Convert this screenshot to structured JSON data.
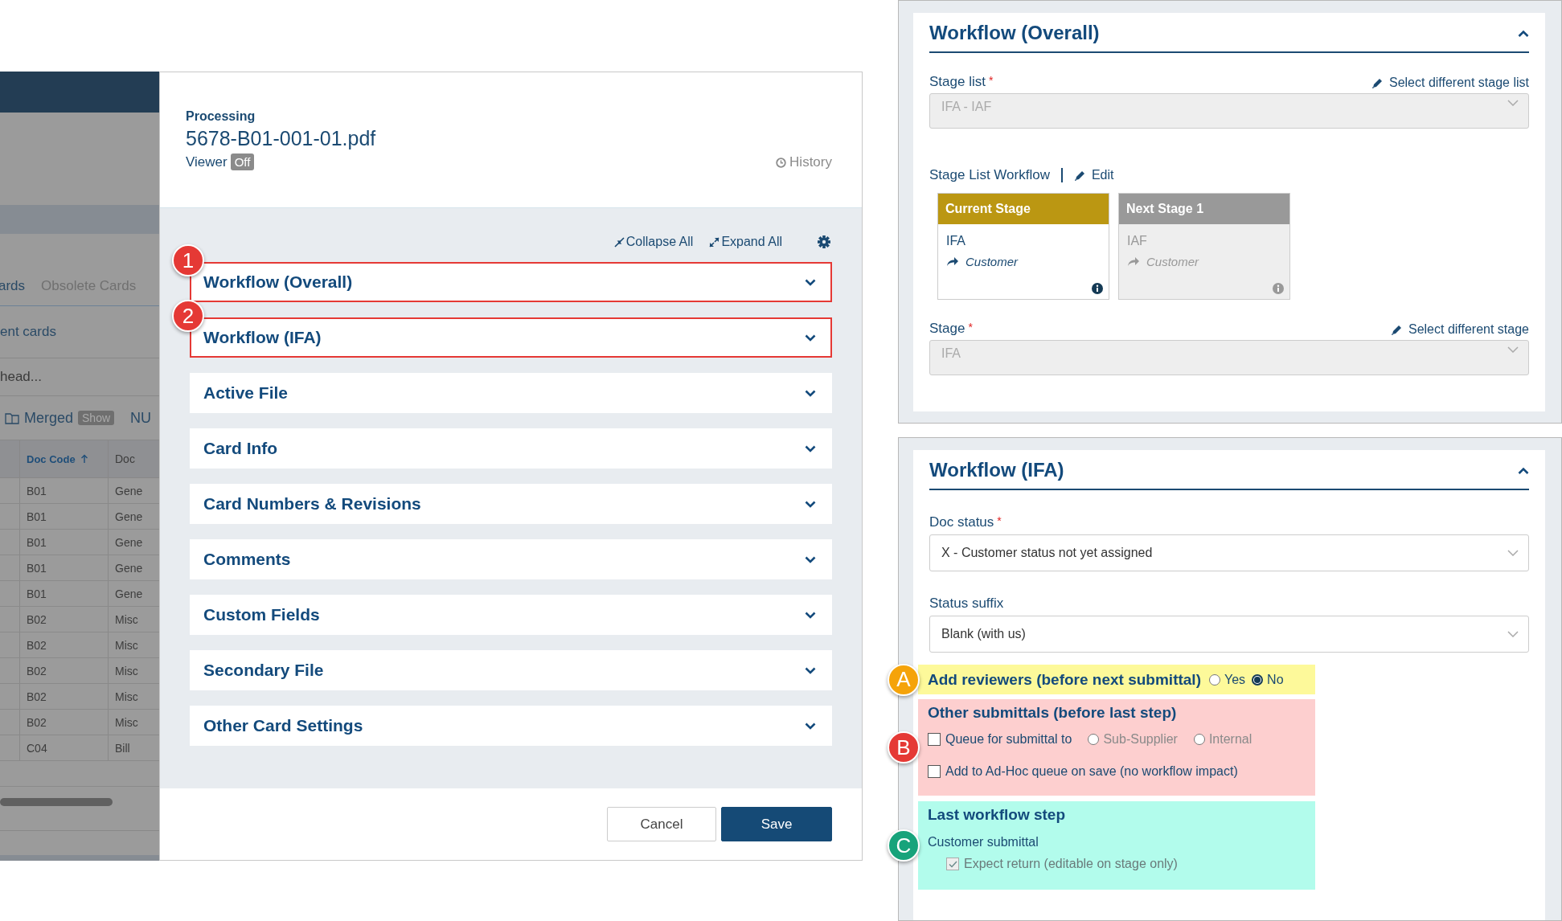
{
  "background_app": {
    "tabs": [
      {
        "label": "ards",
        "selected": true
      },
      {
        "label": "Obsolete Cards",
        "selected": false
      }
    ],
    "filter_text": "ent cards",
    "search_placeholder": "head...",
    "merged": {
      "label": "Merged",
      "toggle": "Show"
    },
    "next_label": "NU",
    "table": {
      "columns": [
        {
          "label": "Doc Code",
          "sorted": true
        },
        {
          "label": "Doc",
          "sorted": false
        }
      ],
      "rows": [
        {
          "cells": [
            "B01",
            "Gene"
          ]
        },
        {
          "cells": [
            "B01",
            "Gene"
          ]
        },
        {
          "cells": [
            "B01",
            "Gene"
          ]
        },
        {
          "cells": [
            "B01",
            "Gene"
          ]
        },
        {
          "cells": [
            "B01",
            "Gene"
          ]
        },
        {
          "cells": [
            "B02",
            "Misc"
          ]
        },
        {
          "cells": [
            "B02",
            "Misc"
          ]
        },
        {
          "cells": [
            "B02",
            "Misc"
          ]
        },
        {
          "cells": [
            "B02",
            "Misc"
          ]
        },
        {
          "cells": [
            "B02",
            "Misc"
          ]
        },
        {
          "cells": [
            "C04",
            "Bill"
          ]
        }
      ]
    }
  },
  "modal": {
    "kicker": "Processing",
    "filename": "5678-B01-001-01.pdf",
    "viewer": {
      "label": "Viewer",
      "toggle": "Off"
    },
    "history": "History",
    "toolbar": {
      "collapse": "Collapse All",
      "expand": "Expand All"
    },
    "sections": [
      {
        "title": "Workflow (Overall)",
        "expanded": false,
        "highlighted": true,
        "marker": {
          "label": "1",
          "color": "#e53935"
        }
      },
      {
        "title": "Workflow (IFA)",
        "expanded": false,
        "highlighted": true,
        "marker": {
          "label": "2",
          "color": "#e53935"
        }
      },
      {
        "title": "Active File",
        "expanded": false,
        "highlighted": false
      },
      {
        "title": "Card Info",
        "expanded": false,
        "highlighted": false
      },
      {
        "title": "Card Numbers & Revisions",
        "expanded": false,
        "highlighted": false
      },
      {
        "title": "Comments",
        "expanded": false,
        "highlighted": false
      },
      {
        "title": "Custom Fields",
        "expanded": false,
        "highlighted": false
      },
      {
        "title": "Secondary File",
        "expanded": false,
        "highlighted": false
      },
      {
        "title": "Other Card Settings",
        "expanded": false,
        "highlighted": false
      }
    ],
    "buttons": [
      {
        "label": "Cancel",
        "kind": "secondary"
      },
      {
        "label": "Save",
        "kind": "primary"
      }
    ]
  },
  "overall_panel": {
    "title": "Workflow (Overall)",
    "expanded": true,
    "stage_list": {
      "label": "Stage list",
      "required_mark": "*",
      "link": "Select different stage list",
      "value": "IFA - IAF",
      "disabled": true
    },
    "workflow": {
      "label": "Stage List Workflow",
      "edit": "Edit",
      "stages": [
        {
          "header": "Current Stage",
          "name": "IFA",
          "recipient": "Customer",
          "current": true
        },
        {
          "header": "Next Stage 1",
          "name": "IAF",
          "recipient": "Customer",
          "current": false
        }
      ]
    },
    "stage": {
      "label": "Stage",
      "required_mark": "*",
      "link": "Select different stage",
      "value": "IFA",
      "disabled": true
    }
  },
  "ifa_panel": {
    "title": "Workflow (IFA)",
    "expanded": true,
    "fields": [
      {
        "label": "Doc status",
        "required_mark": "*",
        "value": "X - Customer status not yet assigned"
      },
      {
        "label": "Status suffix",
        "value": "Blank (with us)"
      }
    ],
    "bands": [
      {
        "kind": "radio",
        "marker": {
          "label": "A",
          "color": "#f5a30a"
        },
        "label": "Add reviewers (before next submittal)",
        "options": [
          {
            "label": "Yes",
            "selected": false,
            "disabled": false
          },
          {
            "label": "No",
            "selected": true,
            "disabled": false
          }
        ]
      },
      {
        "kind": "checks",
        "marker": {
          "label": "B",
          "color": "#e53935"
        },
        "title": "Other submittals (before last step)",
        "items": [
          {
            "label": "Queue for submittal to",
            "checked": false,
            "disabled": false,
            "options": [
              {
                "label": "Sub-Supplier",
                "selected": false,
                "disabled": true
              },
              {
                "label": "Internal",
                "selected": false,
                "disabled": true
              }
            ]
          },
          {
            "label": "Add to Ad-Hoc queue on save (no workflow impact)",
            "checked": false,
            "disabled": false
          }
        ]
      },
      {
        "kind": "summary",
        "marker": {
          "label": "C",
          "color": "#17a37b"
        },
        "title": "Last workflow step",
        "value": "Customer submittal",
        "items": [
          {
            "label": "Expect return (editable on stage only)",
            "checked": true,
            "disabled": true
          }
        ]
      }
    ]
  }
}
